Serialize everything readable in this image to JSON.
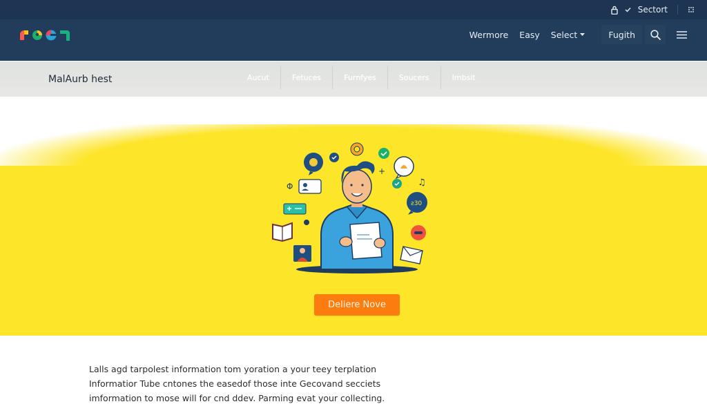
{
  "utility_bar": {
    "lock_icon": "lock-icon",
    "check_icon": "check-icon",
    "label": "Sectort",
    "grid_icon": "apps-icon"
  },
  "header": {
    "logo": {
      "name": "multicolor-logo",
      "colors": [
        "#ff5a4e",
        "#ffc21a",
        "#1db06a",
        "#2aa3d8",
        "#e8475d",
        "#16b27f"
      ]
    },
    "nav": [
      {
        "label": "Wermore"
      },
      {
        "label": "Easy"
      },
      {
        "label": "Select",
        "has_dropdown": true
      }
    ],
    "pill_button": "Fugith",
    "search_icon": "search-icon",
    "menu_icon": "hamburger-menu-icon"
  },
  "subheader": {
    "brand": "MalAurb hest",
    "items": [
      {
        "label": "Aucut"
      },
      {
        "label": "Fetuces"
      },
      {
        "label": "Furnfyes"
      },
      {
        "label": "Soucers"
      },
      {
        "label": "Imbsit"
      }
    ]
  },
  "hero": {
    "background_color": "#fde52a",
    "illustration": "person-reading-document-with-icons",
    "cta_label": "Deliere Nove",
    "cta_color": "#fd7c0f"
  },
  "content": {
    "lines": [
      "Lalls agd tarpolest information tom yoration a your teey terplation",
      "Informatior Tube cntones the easedof those inte Gecovand secciets",
      "imformation to mose will for cnd ddev.  Parming evat your collecting."
    ]
  }
}
